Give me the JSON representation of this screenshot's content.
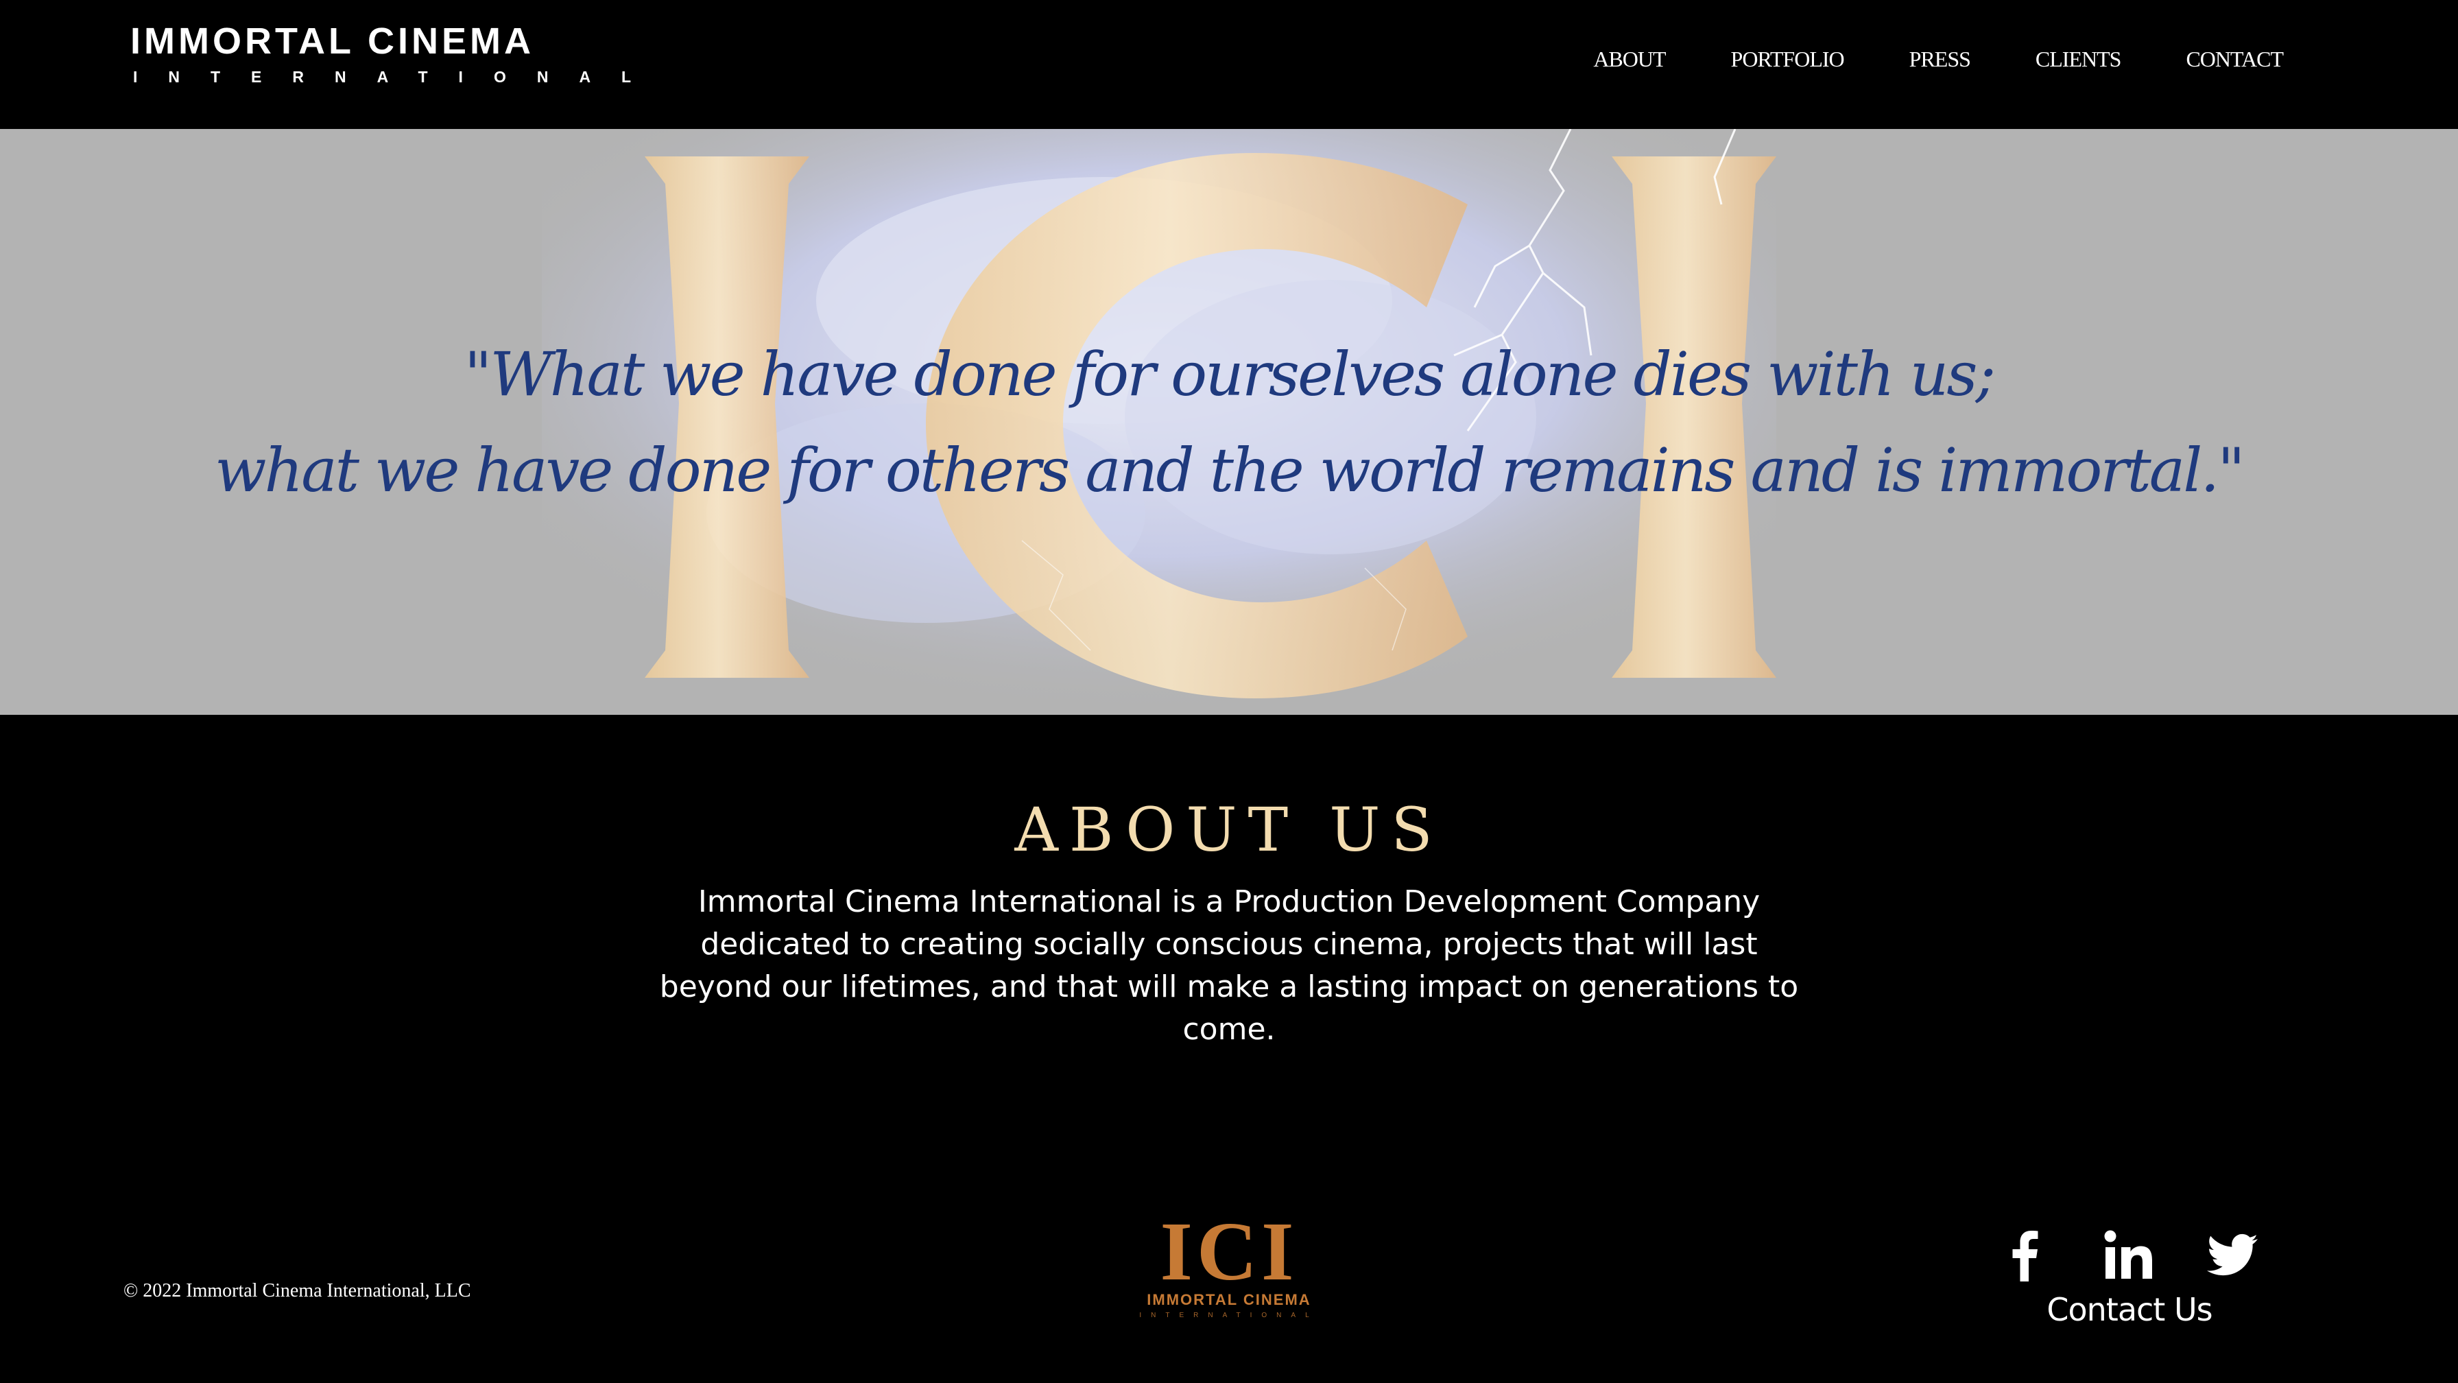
{
  "header": {
    "brand_name": "IMMORTAL CINEMA",
    "brand_sub": "INTERNATIONAL",
    "nav": [
      "ABOUT",
      "PORTFOLIO",
      "PRESS",
      "CLIENTS",
      "CONTACT"
    ]
  },
  "hero": {
    "quote_line1": "\"What we have done for ourselves alone dies with us;",
    "quote_line2": "what we have done for others and the world remains and is immortal.\"",
    "background_art_letters": "ICI"
  },
  "about": {
    "title": "ABOUT US",
    "body": "Immortal Cinema International is a Production Development Company dedicated to creating socially conscious cinema, projects that will last beyond our lifetimes, and that will make a lasting impact on generations to come."
  },
  "footer": {
    "copyright": "© 2022 Immortal Cinema International, LLC",
    "logo_letters": "ICI",
    "logo_name": "IMMORTAL CINEMA",
    "logo_sub": "INTERNATIONAL",
    "social": [
      "facebook-icon",
      "linkedin-icon",
      "twitter-icon"
    ],
    "contact_label": "Contact Us"
  },
  "colors": {
    "page_background": "#000000",
    "hero_background": "#b3b3b3",
    "quote": "#1f3a7e",
    "about_title": "#f3dcaf",
    "logo_gold": "#c67a35"
  }
}
